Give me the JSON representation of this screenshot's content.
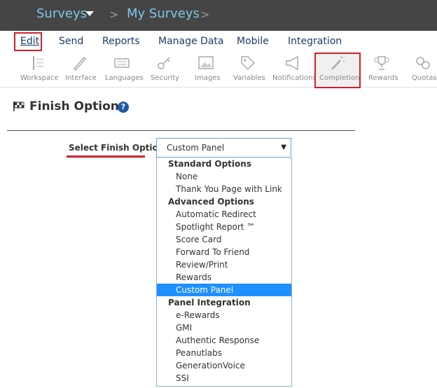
{
  "topbar": {
    "crumb1": "Surveys",
    "sep1": ">",
    "crumb2": "My Surveys",
    "sep2": ">"
  },
  "nav": [
    "Edit",
    "Send",
    "Reports",
    "Manage Data",
    "Mobile",
    "Integration"
  ],
  "toolbar": [
    "Workspace",
    "Interface",
    "Languages",
    "Security",
    "Images",
    "Variables",
    "Notifications",
    "Completion",
    "Rewards",
    "Quotas"
  ],
  "page": {
    "title": "Finish Options",
    "help": "?"
  },
  "form": {
    "label": "Select Finish Option",
    "selected": "Custom Panel",
    "arrow": "▼"
  },
  "options": [
    {
      "text": "Standard Options",
      "group": true
    },
    {
      "text": "None"
    },
    {
      "text": "Thank You Page with Link"
    },
    {
      "text": "Advanced Options",
      "group": true
    },
    {
      "text": "Automatic Redirect"
    },
    {
      "text": "Spotlight Report ™"
    },
    {
      "text": "Score Card"
    },
    {
      "text": "Forward To Friend"
    },
    {
      "text": "Review/Print"
    },
    {
      "text": "Rewards"
    },
    {
      "text": "Custom Panel",
      "selected": true
    },
    {
      "text": "Panel Integration",
      "group": true
    },
    {
      "text": "e-Rewards"
    },
    {
      "text": "GMI"
    },
    {
      "text": "Authentic Response"
    },
    {
      "text": "Peanutlabs"
    },
    {
      "text": "GenerationVoice"
    },
    {
      "text": "SSI"
    }
  ]
}
